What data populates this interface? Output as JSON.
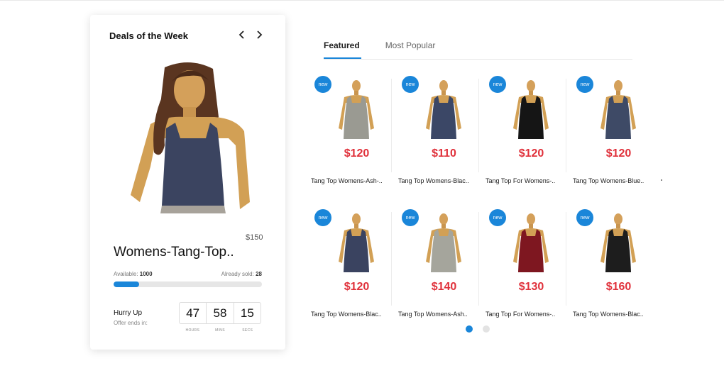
{
  "deal": {
    "title": "Deals of the Week",
    "price": "$150",
    "name": "Womens-Tang-Top..",
    "available_label": "Available:",
    "available_value": "1000",
    "sold_label": "Already sold:",
    "sold_value": "28",
    "sold_progress_percent": 17,
    "hurry": "Hurry Up",
    "offer": "Offer ends in:",
    "timer": {
      "hours": "47",
      "mins": "58",
      "secs": "15"
    },
    "timer_labels": {
      "hours": "HOURS",
      "mins": "MINS",
      "secs": "SECS"
    }
  },
  "tabs": [
    {
      "label": "Featured",
      "active": true
    },
    {
      "label": "Most Popular",
      "active": false
    }
  ],
  "badge_label": "new",
  "products": [
    {
      "price": "$120",
      "name": "Tang Top Womens-Ash-..",
      "color": "#9a9a92"
    },
    {
      "price": "$110",
      "name": "Tang Top Womens-Blac..",
      "color": "#3b4766"
    },
    {
      "price": "$120",
      "name": "Tang Top For Womens-..",
      "color": "#151515"
    },
    {
      "price": "$120",
      "name": "Tang Top Womens-Blue..",
      "color": "#3e4a66"
    },
    {
      "price": "$120",
      "name": "Tang Top Womens-Blac..",
      "color": "#3a4360"
    },
    {
      "price": "$140",
      "name": "Tang Top Womens-Ash..",
      "color": "#a5a59c"
    },
    {
      "price": "$130",
      "name": "Tang Top For Womens-..",
      "color": "#7e1720"
    },
    {
      "price": "$160",
      "name": "Tang Top Womens-Blac..",
      "color": "#1d1d1d"
    }
  ],
  "pagination": {
    "pages": 2,
    "active": 1
  },
  "colors": {
    "accent": "#1a86d9",
    "price": "#e0313b"
  }
}
